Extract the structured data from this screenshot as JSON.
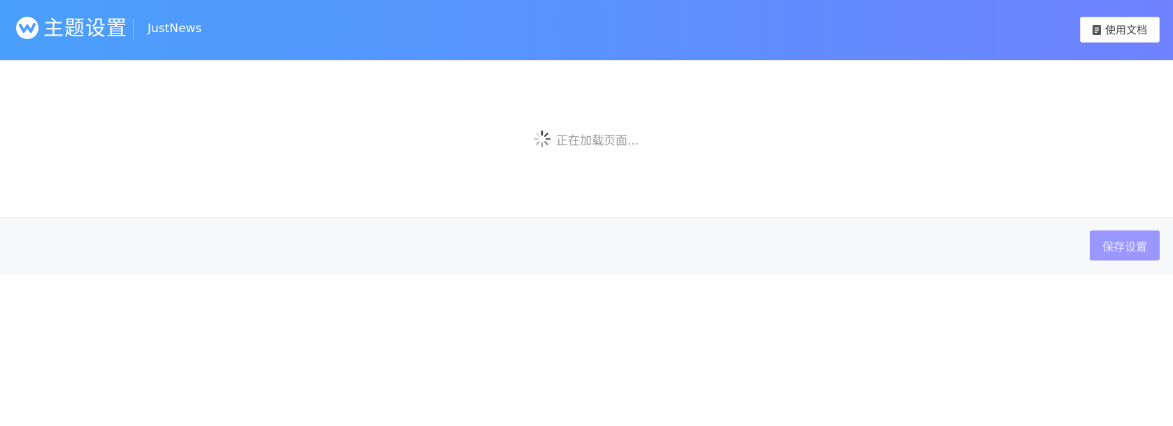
{
  "header": {
    "title": "主题设置",
    "subtitle": "JustNews",
    "doc_button_label": "使用文档",
    "logo_icon": "wp-logo-icon",
    "doc_icon": "document-icon"
  },
  "main": {
    "loading_text": "正在加载页面..."
  },
  "footer": {
    "save_label": "保存设置",
    "save_disabled": true
  },
  "colors": {
    "header_gradient_start": "#4a9ffc",
    "header_gradient_end": "#6f82ff",
    "save_button": "#9a98ff",
    "footer_background": "#f7f8fa"
  }
}
